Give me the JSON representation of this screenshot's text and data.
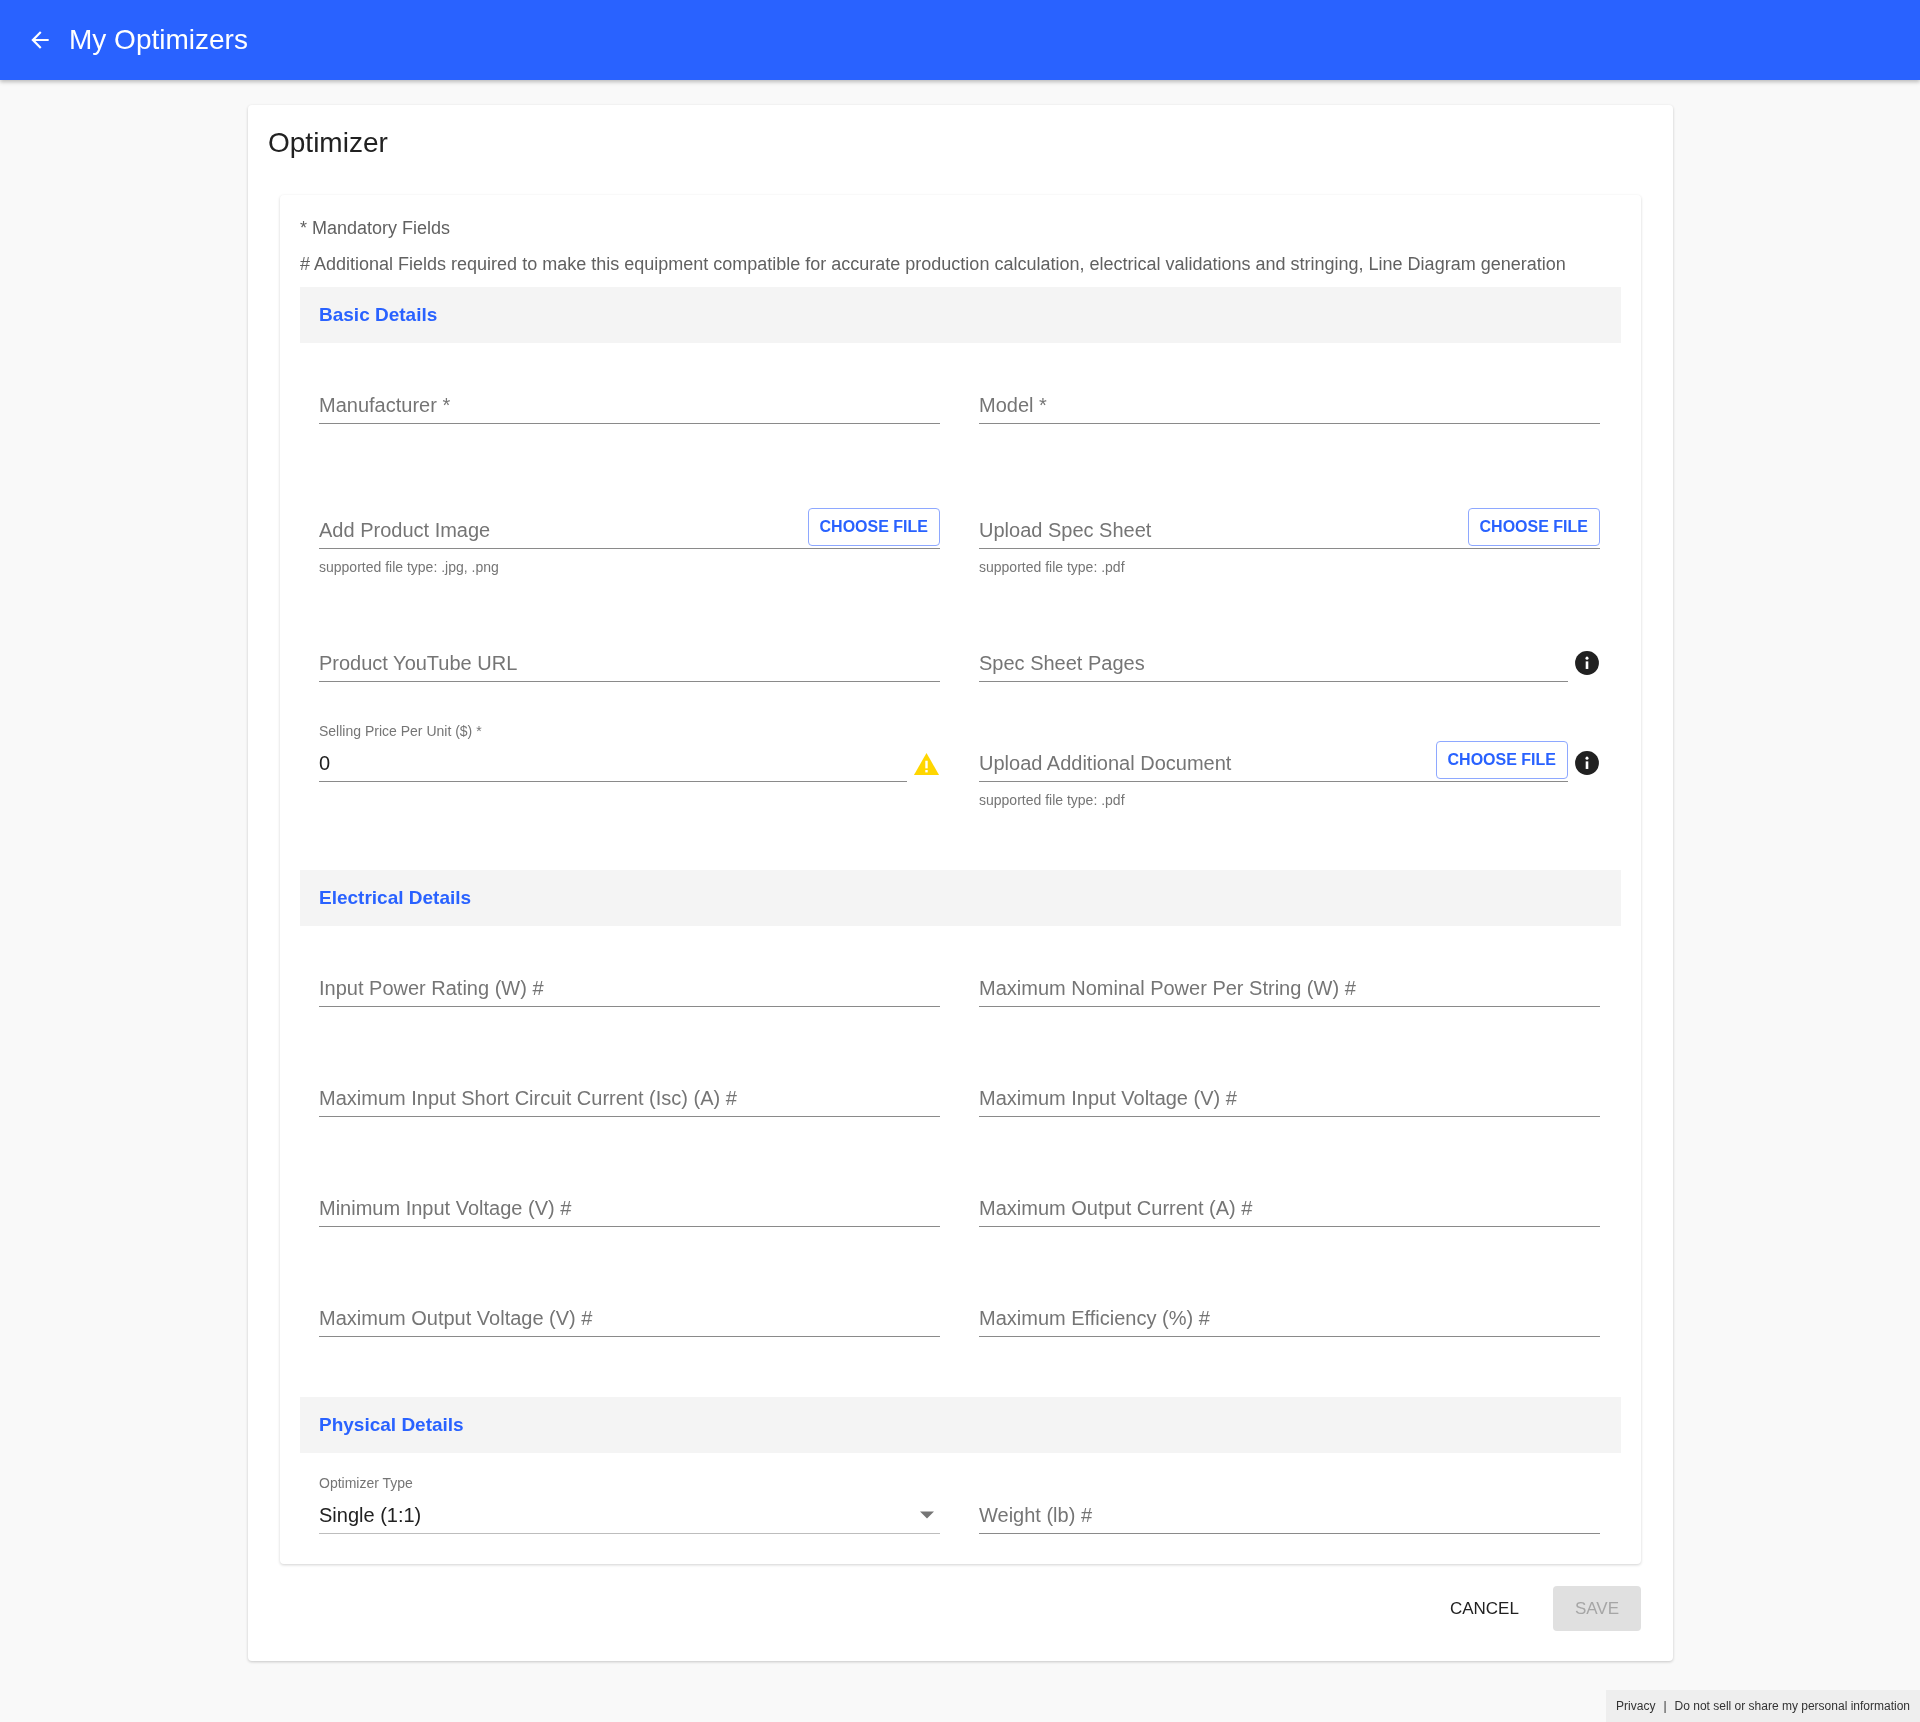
{
  "header": {
    "title": "My Optimizers"
  },
  "page_title": "Optimizer",
  "notes": [
    "* Mandatory Fields",
    "# Additional Fields required to make this equipment compatible for accurate production calculation, electrical validations and stringing, Line Diagram generation"
  ],
  "sections": [
    {
      "title": "Basic Details",
      "rows": [
        [
          {
            "kind": "text",
            "placeholder": "Manufacturer *"
          },
          {
            "kind": "text",
            "placeholder": "Model *"
          }
        ],
        [
          {
            "kind": "file",
            "placeholder": "Add Product Image",
            "button": "CHOOSE FILE",
            "helper": "supported file type: .jpg, .png"
          },
          {
            "kind": "file",
            "placeholder": "Upload Spec Sheet",
            "button": "CHOOSE FILE",
            "helper": "supported file type: .pdf"
          }
        ],
        [
          {
            "kind": "text",
            "placeholder": "Product YouTube URL"
          },
          {
            "kind": "text",
            "placeholder": "Spec Sheet Pages",
            "info": true
          }
        ],
        [
          {
            "kind": "number",
            "label": "Selling Price Per Unit ($) *",
            "value": "0",
            "warning": true
          },
          {
            "kind": "file",
            "placeholder": "Upload Additional Document",
            "button": "CHOOSE FILE",
            "helper": "supported file type: .pdf",
            "info": true
          }
        ]
      ]
    },
    {
      "title": "Electrical Details",
      "rows": [
        [
          {
            "kind": "text",
            "placeholder": "Input Power Rating (W) #"
          },
          {
            "kind": "text",
            "placeholder": "Maximum Nominal Power Per String (W) #"
          }
        ],
        [
          {
            "kind": "text",
            "placeholder": "Maximum Input Short Circuit Current (Isc) (A) #"
          },
          {
            "kind": "text",
            "placeholder": "Maximum Input Voltage (V) #"
          }
        ],
        [
          {
            "kind": "text",
            "placeholder": "Minimum Input Voltage (V) #"
          },
          {
            "kind": "text",
            "placeholder": "Maximum Output Current (A) #"
          }
        ],
        [
          {
            "kind": "text",
            "placeholder": "Maximum Output Voltage (V) #"
          },
          {
            "kind": "text",
            "placeholder": "Maximum Efficiency (%) #"
          }
        ]
      ]
    },
    {
      "title": "Physical Details",
      "rows": [
        [
          {
            "kind": "select",
            "label": "Optimizer Type",
            "value": "Single (1:1)"
          },
          {
            "kind": "text",
            "placeholder": "Weight (lb) #"
          }
        ]
      ]
    }
  ],
  "buttons": [
    {
      "label": "CANCEL",
      "disabled": false
    },
    {
      "label": "SAVE",
      "disabled": true
    }
  ],
  "footer": {
    "links": [
      "Privacy",
      "Do not sell or share my personal information"
    ],
    "separator": "|"
  }
}
